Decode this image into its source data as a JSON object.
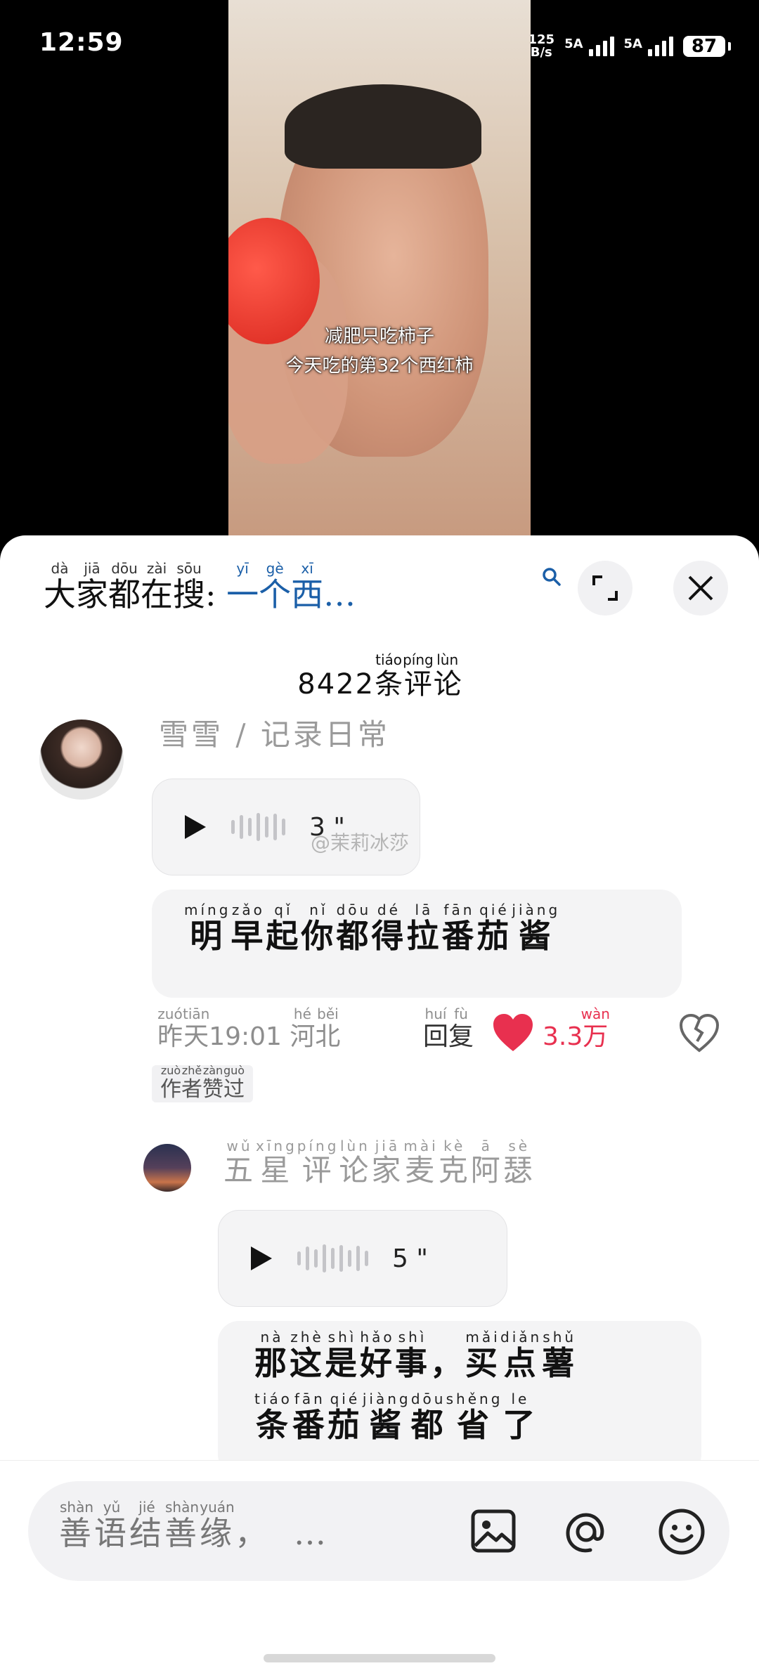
{
  "status_bar": {
    "time": "12:59",
    "net_speed_value": "125",
    "net_speed_unit": "B/s",
    "sim1": "5A",
    "sim2": "5A",
    "battery": "87"
  },
  "video": {
    "caption_line1": "减肥只吃柿子",
    "caption_line2": "今天吃的第32个西红柿"
  },
  "search_bar": {
    "label": [
      {
        "char": "大",
        "py": "dà"
      },
      {
        "char": "家",
        "py": "jiā"
      },
      {
        "char": "都",
        "py": "dōu"
      },
      {
        "char": "在",
        "py": "zài"
      },
      {
        "char": "搜",
        "py": "sōu"
      }
    ],
    "colon": ":",
    "query": [
      {
        "char": "一",
        "py": "yī"
      },
      {
        "char": "个",
        "py": "gè"
      },
      {
        "char": "西",
        "py": "xī"
      }
    ],
    "ellipsis": "…"
  },
  "comments_header": {
    "count": "8422",
    "label": [
      {
        "char": "条",
        "py": "tiáo"
      },
      {
        "char": "评",
        "py": "píng"
      },
      {
        "char": "论",
        "py": "lùn"
      }
    ]
  },
  "comments": [
    {
      "username": "雪雪 / 记录日常",
      "voice_duration": "3 \"",
      "text": [
        {
          "char": "明",
          "py": "míng"
        },
        {
          "char": "早",
          "py": "zǎo"
        },
        {
          "char": "起",
          "py": "qǐ"
        },
        {
          "char": "你",
          "py": "nǐ"
        },
        {
          "char": "都",
          "py": "dōu"
        },
        {
          "char": "得",
          "py": "dé"
        },
        {
          "char": "拉",
          "py": "lā"
        },
        {
          "char": "番",
          "py": "fān"
        },
        {
          "char": "茄",
          "py": "qié"
        },
        {
          "char": "酱",
          "py": "jiàng"
        }
      ],
      "time": [
        {
          "char": "昨",
          "py": "zuó"
        },
        {
          "char": "天",
          "py": "tiān"
        }
      ],
      "clock": "19:01",
      "location": [
        {
          "char": "河",
          "py": "hé"
        },
        {
          "char": "北",
          "py": "běi"
        }
      ],
      "reply": [
        {
          "char": "回",
          "py": "huí"
        },
        {
          "char": "复",
          "py": "fù"
        }
      ],
      "likes_num": "3.3",
      "likes_unit": {
        "char": "万",
        "py": "wàn"
      },
      "badge": [
        {
          "char": "作",
          "py": "zuò"
        },
        {
          "char": "者",
          "py": "zhě"
        },
        {
          "char": "赞",
          "py": "zàn"
        },
        {
          "char": "过",
          "py": "guò"
        }
      ]
    },
    {
      "username": [
        {
          "char": "五",
          "py": "wǔ"
        },
        {
          "char": "星",
          "py": "xīng"
        },
        {
          "char": "评",
          "py": "píng"
        },
        {
          "char": "论",
          "py": "lùn"
        },
        {
          "char": "家",
          "py": "jiā"
        },
        {
          "char": "麦",
          "py": "mài"
        },
        {
          "char": "克",
          "py": "kè"
        },
        {
          "char": "阿",
          "py": "ā"
        },
        {
          "char": "瑟",
          "py": "sè"
        }
      ],
      "voice_duration": "5 \"",
      "text_line1": [
        {
          "char": "那",
          "py": "nà"
        },
        {
          "char": "这",
          "py": "zhè"
        },
        {
          "char": "是",
          "py": "shì"
        },
        {
          "char": "好",
          "py": "hǎo"
        },
        {
          "char": "事",
          "py": "shì"
        },
        {
          "char": "，",
          "py": ""
        },
        {
          "char": "买",
          "py": "mǎi"
        },
        {
          "char": "点",
          "py": "diǎn"
        },
        {
          "char": "薯",
          "py": "shǔ"
        }
      ],
      "text_line2": [
        {
          "char": "条",
          "py": "tiáo"
        },
        {
          "char": "番",
          "py": "fān"
        },
        {
          "char": "茄",
          "py": "qié"
        },
        {
          "char": "酱",
          "py": "jiàng"
        },
        {
          "char": "都",
          "py": "dōu"
        },
        {
          "char": "省",
          "py": "shěng"
        },
        {
          "char": "了",
          "py": "le"
        }
      ]
    }
  ],
  "watermark": "@茉莉冰莎",
  "input_bar": {
    "placeholder": [
      {
        "char": "善",
        "py": "shàn"
      },
      {
        "char": "语",
        "py": "yǔ"
      },
      {
        "char": "结",
        "py": "jié"
      },
      {
        "char": "善",
        "py": "shàn"
      },
      {
        "char": "缘",
        "py": "yuán"
      },
      {
        "char": "，",
        "py": ""
      }
    ],
    "ellipsis": "…",
    "icons": [
      "image-icon",
      "at-icon",
      "emoji-icon"
    ]
  },
  "colors": {
    "like_red": "#e8304f",
    "query_blue": "#1b5fa8",
    "sheet_bg": "#ffffff",
    "bubble_bg": "#f4f4f5"
  }
}
